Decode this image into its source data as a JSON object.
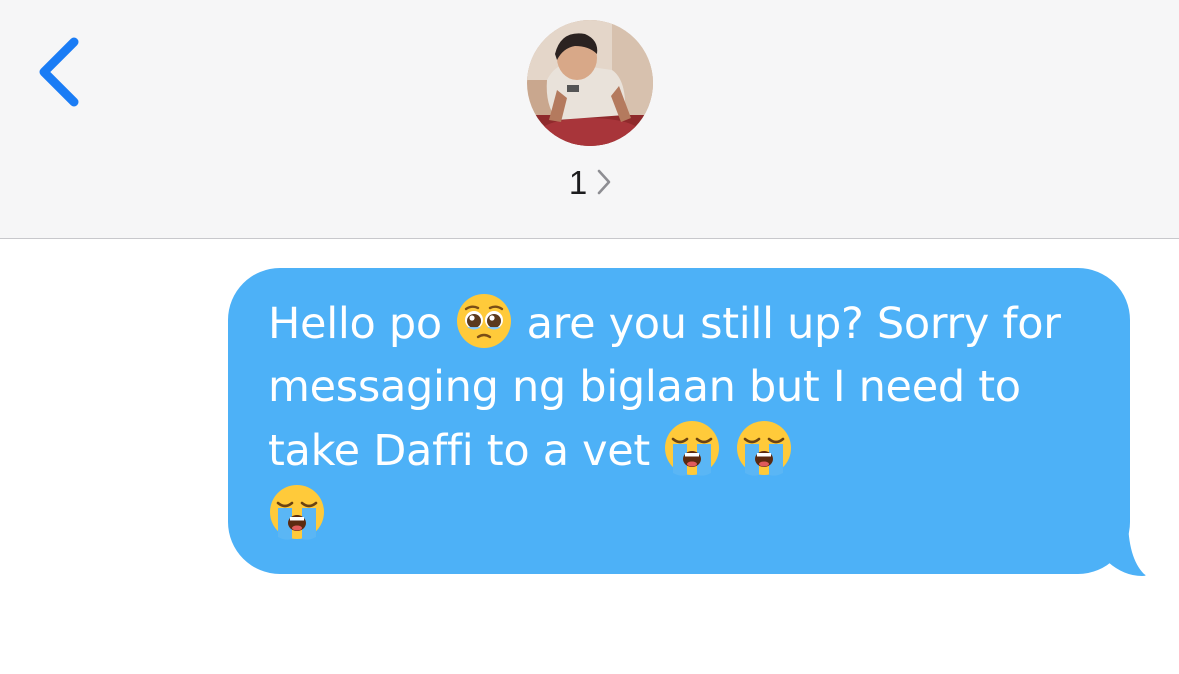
{
  "header": {
    "back_icon": "chevron-left-icon",
    "avatar_icon": "contact-photo",
    "contact_name": "1",
    "contact_chevron_icon": "chevron-right-icon",
    "accent_color": "#1a7cf5",
    "background_color": "#f6f6f7"
  },
  "message": {
    "direction": "sent",
    "bubble_color": "#4db1f7",
    "text_color": "#ffffff",
    "segments": {
      "s1": "Hello po",
      "e1": "pleading-face-emoji",
      "s2": "are you still up? Sorry for messaging ng biglaan but I need to take Daffi to a vet",
      "e2": "loudly-crying-face-emoji",
      "e3": "loudly-crying-face-emoji",
      "e4": "loudly-crying-face-emoji"
    }
  }
}
